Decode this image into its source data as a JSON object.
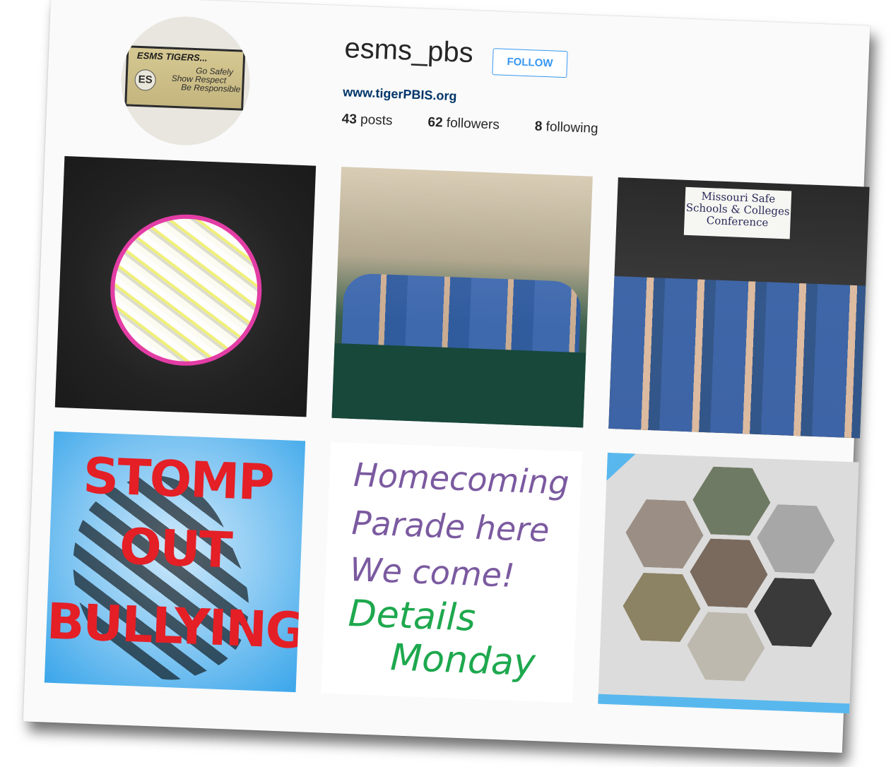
{
  "profile": {
    "username": "esms_pbs",
    "follow_label": "FOLLOW",
    "website": "www.tigerPBIS.org",
    "stats": {
      "posts_count": "43",
      "posts_label": "posts",
      "followers_count": "62",
      "followers_label": "followers",
      "following_count": "8",
      "following_label": "following"
    },
    "avatar_sign": {
      "title": "ESMS TIGERS...",
      "logo": "ES",
      "line1": "Go Safely",
      "line2": "Show Respect",
      "line3": "Be Responsible"
    }
  },
  "posts": {
    "stage_banner": "Missouri Safe Schools & Colleges Conference",
    "stomp": {
      "line1": "STOMP",
      "line2": "OUT",
      "line3": "BULLYING"
    },
    "homecoming": {
      "line1": "Homecoming",
      "line2": "Parade here",
      "line3": "We come!",
      "line4": "Details",
      "line5": "Monday"
    }
  },
  "colors": {
    "accent": "#3897f0",
    "link": "#003569",
    "stomp_red": "#e41f26",
    "stomp_blue": "#79c2f1"
  }
}
